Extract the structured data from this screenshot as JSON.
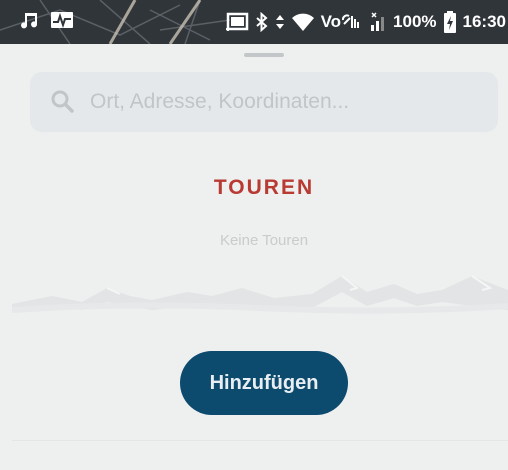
{
  "status_bar": {
    "left_icons": [
      "music-note-icon",
      "activity-image-icon"
    ],
    "right_icons": [
      "cast-icon",
      "bluetooth-icon",
      "data-arrows-icon",
      "wifi-icon",
      "volte-icon",
      "signal-icon",
      "battery-charging-icon"
    ],
    "volte_label": "Vo",
    "battery_percent": "100%",
    "time": "16:30"
  },
  "search": {
    "placeholder": "Ort, Adresse, Koordinaten...",
    "icon": "search-icon"
  },
  "tours": {
    "title": "TOUREN",
    "empty_text": "Keine Touren"
  },
  "add_button": {
    "label": "Hinzufügen"
  },
  "colors": {
    "accent_red": "#b83a33",
    "button_blue": "#0c4a6e",
    "sheet_background": "#eeefef",
    "status_bar": "#2a2e33"
  }
}
